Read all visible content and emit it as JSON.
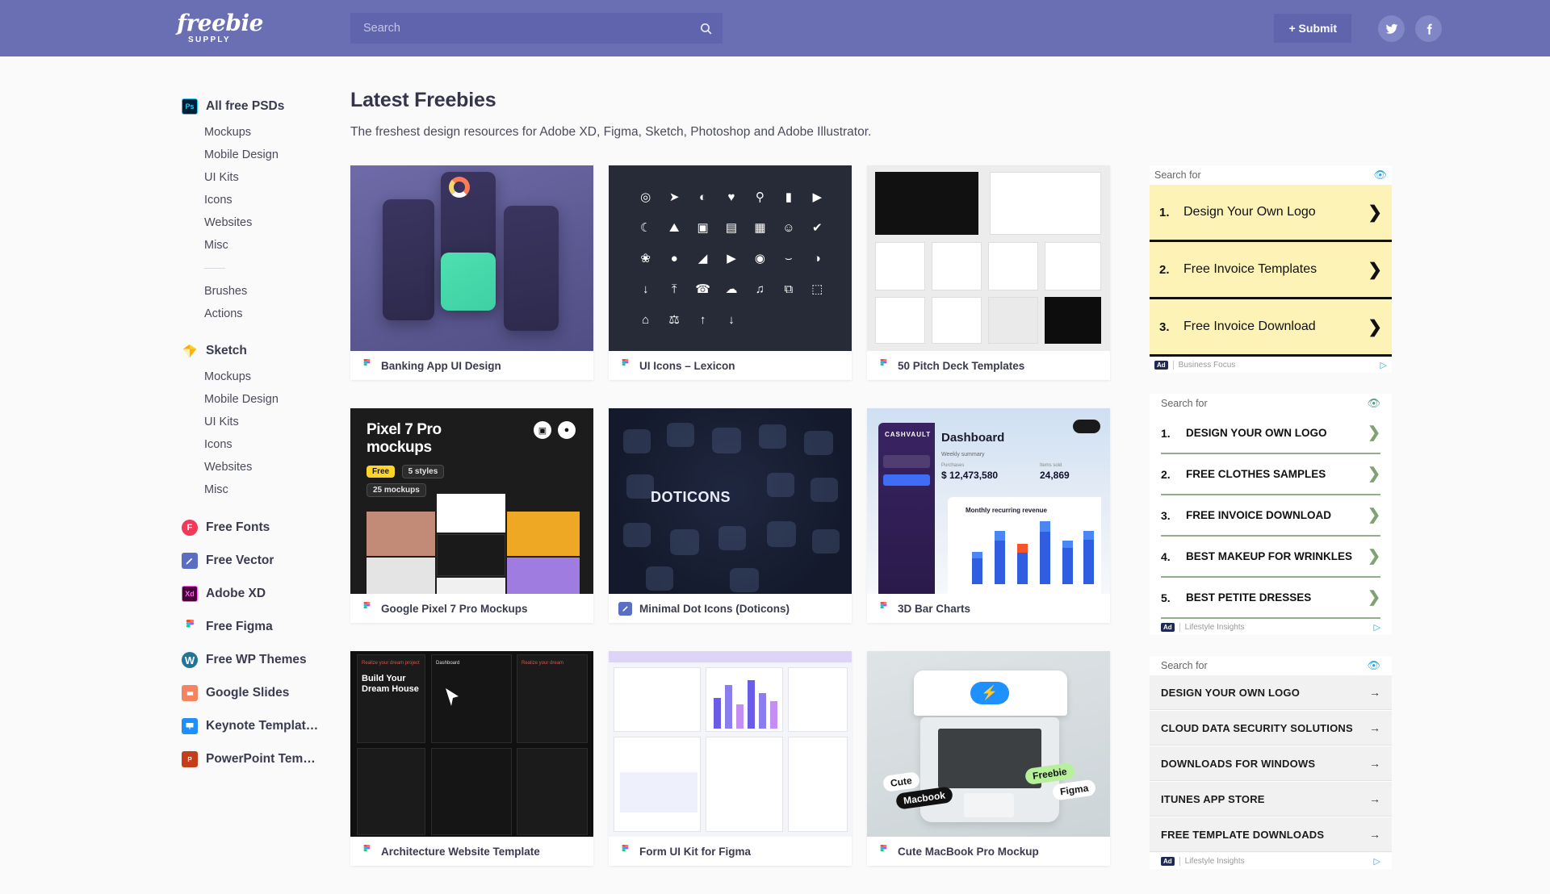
{
  "header": {
    "logo_main": "freebie",
    "logo_sub": "SUPPLY",
    "search_placeholder": "Search",
    "search_value": "",
    "search_icon": "search-icon",
    "submit_label": "+ Submit",
    "twitter_icon": "twitter-icon",
    "facebook_icon": "facebook-icon",
    "bg_color": "#6a6fb4"
  },
  "sidebar": {
    "groups": [
      {
        "icon": "photoshop-icon",
        "icon_text": "Ps",
        "label": "All free PSDs",
        "items": [
          "Mockups",
          "Mobile Design",
          "UI Kits",
          "Icons",
          "Websites",
          "Misc"
        ],
        "extra_items": [
          "Brushes",
          "Actions"
        ]
      },
      {
        "icon": "sketch-icon",
        "icon_text": "◆",
        "label": "Sketch",
        "items": [
          "Mockups",
          "Mobile Design",
          "UI Kits",
          "Icons",
          "Websites",
          "Misc"
        ],
        "extra_items": []
      }
    ],
    "singles": [
      {
        "icon": "free-fonts-icon",
        "icon_text": "F",
        "label": "Free Fonts"
      },
      {
        "icon": "free-vector-icon",
        "icon_text": "✎",
        "label": "Free Vector"
      },
      {
        "icon": "adobe-xd-icon",
        "icon_text": "Xd",
        "label": "Adobe XD"
      },
      {
        "icon": "figma-icon",
        "icon_text": "",
        "label": "Free Figma"
      },
      {
        "icon": "wordpress-icon",
        "icon_text": "W",
        "label": "Free WP Themes"
      },
      {
        "icon": "google-slides-icon",
        "icon_text": "☰",
        "label": "Google Slides"
      },
      {
        "icon": "keynote-icon",
        "icon_text": "▣",
        "label": "Keynote Templat…"
      },
      {
        "icon": "powerpoint-icon",
        "icon_text": "P",
        "label": "PowerPoint Tem…"
      }
    ]
  },
  "main": {
    "title": "Latest Freebies",
    "subtitle": "The freshest design resources for Adobe XD, Figma, Sketch, Photoshop and Adobe Illustrator.",
    "cards": [
      {
        "title": "Banking App UI Design",
        "source_icon": "figma-icon"
      },
      {
        "title": "UI Icons – Lexicon",
        "source_icon": "figma-icon"
      },
      {
        "title": "50 Pitch Deck Templates",
        "source_icon": "figma-icon"
      },
      {
        "title": "Google Pixel 7 Pro Mockups",
        "source_icon": "figma-icon"
      },
      {
        "title": "Minimal Dot Icons (Doticons)",
        "source_icon": "free-vector-icon"
      },
      {
        "title": "3D Bar Charts",
        "source_icon": "figma-icon"
      },
      {
        "title": "Architecture Website Template",
        "source_icon": "figma-icon"
      },
      {
        "title": "Form UI Kit for Figma",
        "source_icon": "figma-icon"
      },
      {
        "title": "Cute MacBook Pro Mockup",
        "source_icon": "figma-icon"
      }
    ],
    "thumb_text": {
      "pixel_title_line1": "Pixel 7 Pro",
      "pixel_title_line2": "mockups",
      "pixel_tag_free": "Free",
      "pixel_tag_styles": "5 styles",
      "pixel_tag_mockups": "25 mockups",
      "dot_word": "DOTICONS",
      "dash_brand": "CASHVAULT",
      "dash_title": "Dashboard",
      "dash_weekly": "Weekly summary",
      "dash_purchases_label": "Purchases",
      "dash_purchases_value": "$ 12,473,580",
      "dash_items_label": "Items sold",
      "dash_items_value": "24,869",
      "dash_chart_title": "Monthly recurring revenue",
      "mac_badge_cute": "Cute",
      "mac_badge_macbook": "Macbook",
      "mac_badge_freebie": "Freebie",
      "mac_badge_figma": "Figma"
    }
  },
  "ads": [
    {
      "head_label": "Search for",
      "eye_icon": "hide-ad-icon",
      "style": "yellow",
      "rows": [
        {
          "num": "1.",
          "text": "Design Your Own Logo",
          "arrow": "❯"
        },
        {
          "num": "2.",
          "text": "Free Invoice Templates",
          "arrow": "❯"
        },
        {
          "num": "3.",
          "text": "Free Invoice Download",
          "arrow": "❯"
        }
      ],
      "footer_tag": "Ad",
      "footer_source": "Business Focus",
      "footer_icon": "adchoices-icon"
    },
    {
      "head_label": "Search for",
      "eye_icon": "hide-ad-icon",
      "style": "green",
      "rows": [
        {
          "num": "1.",
          "text": "DESIGN YOUR OWN LOGO",
          "arrow": "❯"
        },
        {
          "num": "2.",
          "text": "FREE CLOTHES SAMPLES",
          "arrow": "❯"
        },
        {
          "num": "3.",
          "text": "FREE INVOICE DOWNLOAD",
          "arrow": "❯"
        },
        {
          "num": "4.",
          "text": "BEST MAKEUP FOR WRINKLES",
          "arrow": "❯"
        },
        {
          "num": "5.",
          "text": "BEST PETITE DRESSES",
          "arrow": "❯"
        }
      ],
      "footer_tag": "Ad",
      "footer_source": "Lifestyle Insights",
      "footer_icon": "adchoices-icon"
    },
    {
      "head_label": "Search for",
      "eye_icon": "hide-ad-icon",
      "style": "grey",
      "rows": [
        {
          "num": "",
          "text": "DESIGN YOUR OWN LOGO",
          "arrow": "→"
        },
        {
          "num": "",
          "text": "CLOUD DATA SECURITY SOLUTIONS",
          "arrow": "→"
        },
        {
          "num": "",
          "text": "DOWNLOADS FOR WINDOWS",
          "arrow": "→"
        },
        {
          "num": "",
          "text": "ITUNES APP STORE",
          "arrow": "→"
        },
        {
          "num": "",
          "text": "FREE TEMPLATE DOWNLOADS",
          "arrow": "→"
        }
      ],
      "footer_tag": "Ad",
      "footer_source": "Lifestyle Insights",
      "footer_icon": "adchoices-icon"
    }
  ],
  "icon_set": [
    "◎",
    "✈",
    "◐",
    "♥",
    "⚲",
    "▰",
    "▶",
    "☾",
    "⛰",
    "□",
    "☰",
    "▦",
    "☺",
    "✔",
    "❀",
    "●",
    "◢",
    "▶",
    "◉",
    "⌣",
    "◑",
    "↓",
    "⤒",
    "☎",
    "☁",
    "♫",
    "⧉",
    "⬚",
    "⌂",
    "⚒",
    "↑",
    "↓"
  ]
}
